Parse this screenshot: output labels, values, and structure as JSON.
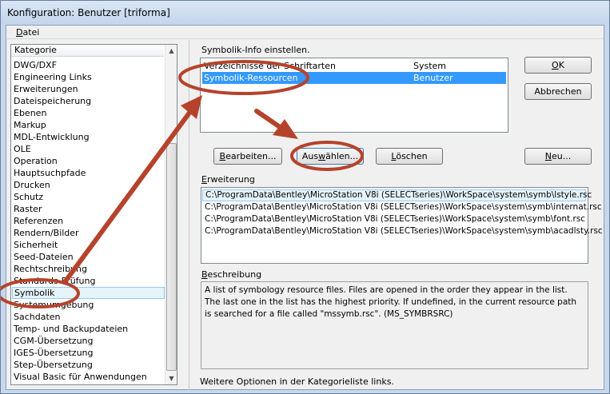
{
  "window": {
    "title": "Konfiguration: Benutzer [triforma]"
  },
  "menu": {
    "datei_hotkey": "D",
    "datei_rest": "atei"
  },
  "category_list": {
    "header": "Kategorie",
    "items": [
      "DWG/DXF",
      "Engineering Links",
      "Erweiterungen",
      "Dateispeicherung",
      "Ebenen",
      "Markup",
      "MDL-Entwicklung",
      "OLE",
      "Operation",
      "Hauptsuchpfade",
      "Drucken",
      "Schutz",
      "Raster",
      "Referenzen",
      "Rendern/Bilder",
      "Sicherheit",
      "Seed-Dateien",
      "Rechtschreibung",
      "Standards-Prüfung",
      "Symbolik",
      "Systemumgebung",
      "Sachdaten",
      "Temp- und Backupdateien",
      "CGM-Übersetzung",
      "IGES-Übersetzung",
      "Step-Übersetzung",
      "Visual Basic für Anwendungen"
    ]
  },
  "symbolik": {
    "label": "Symbolik-Info einstellen.",
    "rows": [
      {
        "name": "Verzeichnisse der Schriftarten",
        "scope": "System"
      },
      {
        "name": "Symbolik-Ressourcen",
        "scope": "Benutzer"
      }
    ]
  },
  "buttons": {
    "ok_hotkey": "O",
    "ok_rest": "K",
    "cancel": "Abbrechen",
    "edit_hotkey": "B",
    "edit_rest": "earbeiten...",
    "select_pre": "Aus",
    "select_hotkey": "w",
    "select_rest": "ählen...",
    "delete_hotkey": "L",
    "delete_rest": "öschen",
    "new_hotkey": "N",
    "new_rest": "eu..."
  },
  "erweiterung": {
    "label_hotkey": "E",
    "label_rest": "rweiterung",
    "paths": [
      "C:\\ProgramData\\Bentley\\MicroStation V8i (SELECTseries)\\WorkSpace\\system\\symb\\lstyle.rsc",
      "C:\\ProgramData\\Bentley\\MicroStation V8i (SELECTseries)\\WorkSpace\\system\\symb\\internat.rsc",
      "C:\\ProgramData\\Bentley\\MicroStation V8i (SELECTseries)\\WorkSpace\\system\\symb\\font.rsc",
      "C:\\ProgramData\\Bentley\\MicroStation V8i (SELECTseries)\\WorkSpace\\system\\symb\\acadlsty.rsc"
    ]
  },
  "beschreibung": {
    "label_hotkey": "B",
    "label_rest": "eschreibung",
    "text": "A list of symbology resource files. Files are opened in the order they appear in the list. The last one in the list has the highest priority. If undefined, in the current resource path is searched for a file called \"mssymb.rsc\". (MS_SYMBRSRC)"
  },
  "footer": {
    "text": "Weitere Optionen in der Kategorieliste links."
  },
  "annotation_color": "#b5432b"
}
